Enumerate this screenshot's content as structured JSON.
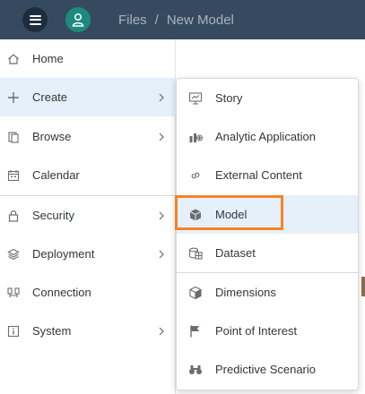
{
  "shell": {
    "breadcrumb": [
      "Files",
      "/",
      "New Model"
    ]
  },
  "nav": {
    "items": [
      {
        "label": "Home",
        "icon": "home-icon",
        "has_submenu": false
      },
      {
        "label": "Create",
        "icon": "plus-icon",
        "has_submenu": true,
        "active": true
      },
      {
        "label": "Browse",
        "icon": "browse-icon",
        "has_submenu": true
      },
      {
        "label": "Calendar",
        "icon": "calendar-icon",
        "has_submenu": false
      },
      {
        "label": "Security",
        "icon": "lock-icon",
        "has_submenu": true
      },
      {
        "label": "Deployment",
        "icon": "deployment-icon",
        "has_submenu": true
      },
      {
        "label": "Connection",
        "icon": "connection-icon",
        "has_submenu": false
      },
      {
        "label": "System",
        "icon": "info-icon",
        "has_submenu": true
      }
    ]
  },
  "submenu": {
    "items": [
      {
        "label": "Story",
        "icon": "presentation-icon"
      },
      {
        "label": "Analytic Application",
        "icon": "analytic-app-icon"
      },
      {
        "label": "External Content",
        "icon": "link-icon"
      },
      {
        "label": "Model",
        "icon": "cube-icon",
        "highlighted": true
      },
      {
        "label": "Dataset",
        "icon": "dataset-icon"
      },
      {
        "label": "Dimensions",
        "icon": "dimensions-icon"
      },
      {
        "label": "Point of Interest",
        "icon": "flag-icon"
      },
      {
        "label": "Predictive Scenario",
        "icon": "binoculars-icon"
      }
    ]
  },
  "colors": {
    "shellbar": "#354a5f",
    "active_item": "#e5f0fa",
    "focus_outline": "#f48423",
    "avatar": "#1c8a7f"
  }
}
